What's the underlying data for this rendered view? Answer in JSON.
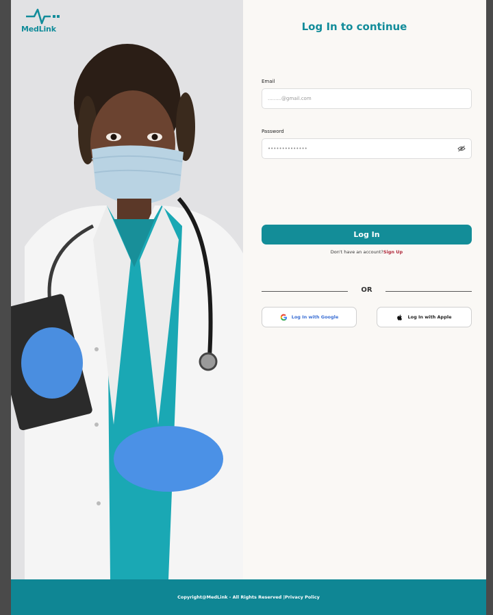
{
  "brand": {
    "name": "MedLink",
    "accent": "#128c9a"
  },
  "form": {
    "title": "Log In to continue",
    "email": {
      "label": "Email",
      "placeholder": ".........@gmail.com"
    },
    "password": {
      "label": "Password",
      "value": "••••••••••••••",
      "toggle_icon": "eye-off-icon"
    },
    "login_label": "Log In",
    "signup_prompt": "Don't have an account?",
    "signup_link": "Sign Up",
    "divider": "OR",
    "google_label": "Log In with Google",
    "apple_label": "Log In with Apple"
  },
  "footer": {
    "copyright": "Copyright@MedLink - All Rights Reserved | ",
    "privacy": "Privacy Policy"
  }
}
